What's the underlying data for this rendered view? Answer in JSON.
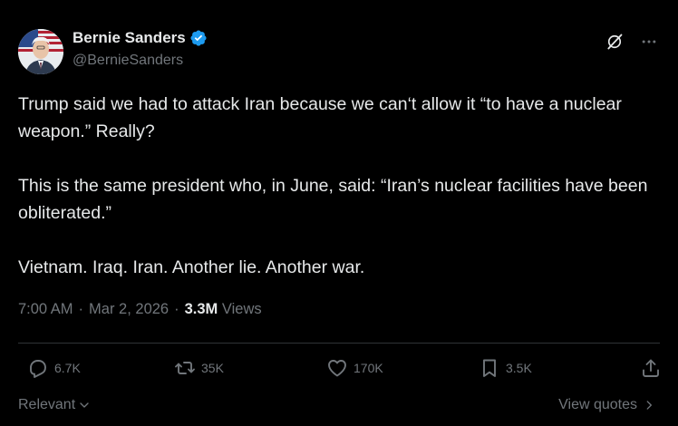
{
  "author": {
    "display_name": "Bernie Sanders",
    "handle": "@BernieSanders",
    "verified_color": "#1d9bf0"
  },
  "tweet": {
    "paragraphs": [
      "Trump said we had to attack Iran because we can‘t allow it “to have a nuclear weapon.” Really?",
      "This is the same president who, in June, said: “Iran’s nuclear facilities have been obliterated.”",
      "Vietnam. Iraq. Iran. Another lie. Another war."
    ]
  },
  "meta": {
    "time": "7:00 AM",
    "sep1": "·",
    "date": "Mar 2, 2026",
    "sep2": "·",
    "views_count": "3.3M",
    "views_label": "Views"
  },
  "actions": {
    "replies": "6.7K",
    "reposts": "35K",
    "likes": "170K",
    "bookmarks": "3.5K"
  },
  "footer": {
    "sort_label": "Relevant",
    "view_quotes_label": "View quotes"
  },
  "icons": {
    "grok": "grok-icon",
    "more": "more-icon",
    "reply": "reply-icon",
    "repost": "repost-icon",
    "like": "like-icon",
    "bookmark": "bookmark-icon",
    "share": "share-icon"
  },
  "colors": {
    "background": "#000000",
    "text": "#e7e9ea",
    "secondary": "#71767b",
    "divider": "#2f3336"
  }
}
